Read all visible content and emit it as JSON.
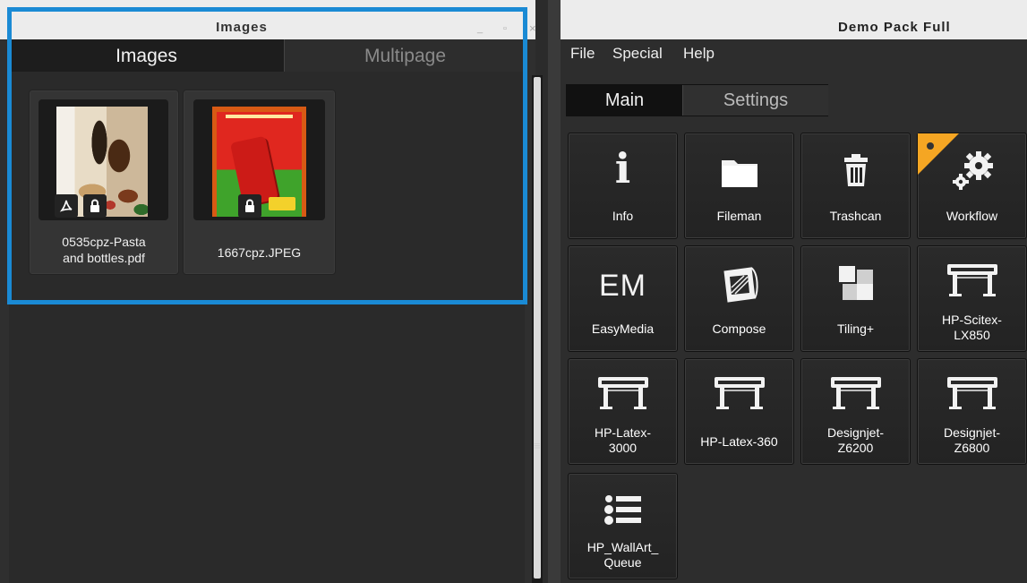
{
  "left_window": {
    "title": "Images",
    "controls": {
      "minimize": "_",
      "maximize": "▫",
      "close": "×"
    },
    "tabs": [
      {
        "label": "Images",
        "active": true
      },
      {
        "label": "Multipage",
        "active": false
      }
    ],
    "files": [
      {
        "name": "0535cpz-Pasta\nand bottles.pdf",
        "badges": [
          "pdf-icon",
          "lock-icon"
        ]
      },
      {
        "name": "1667cpz.JPEG",
        "badges": [
          "lock-icon"
        ]
      }
    ],
    "handle_glyph": "≡"
  },
  "right_window": {
    "title": "Demo Pack Full",
    "menu": [
      "File",
      "Special",
      "Help"
    ],
    "tabs": [
      {
        "label": "Main",
        "active": true
      },
      {
        "label": "Settings",
        "active": false
      }
    ],
    "tiles": [
      {
        "label": "Info",
        "icon": "info-icon"
      },
      {
        "label": "Fileman",
        "icon": "folder-icon"
      },
      {
        "label": "Trashcan",
        "icon": "trash-icon"
      },
      {
        "label": "Workflow",
        "icon": "gears-icon",
        "flag_color": "#f5a623"
      },
      {
        "label": "EasyMedia",
        "icon": "easymedia-icon",
        "icon_text": "EM"
      },
      {
        "label": "Compose",
        "icon": "compose-icon"
      },
      {
        "label": "Tiling+",
        "icon": "tiling-icon"
      },
      {
        "label": "HP-Scitex-\nLX850",
        "icon": "printer-icon"
      },
      {
        "label": "HP-Latex-\n3000",
        "icon": "printer-icon"
      },
      {
        "label": "HP-Latex-360",
        "icon": "printer-icon"
      },
      {
        "label": "Designjet-\nZ6200",
        "icon": "printer-icon"
      },
      {
        "label": "Designjet-\nZ6800",
        "icon": "printer-icon"
      },
      {
        "label": "HP_WallArt_\nQueue",
        "icon": "queue-list-icon"
      }
    ]
  },
  "colors": {
    "selection_border": "#1a8ad4",
    "workflow_flag": "#f5a623"
  }
}
